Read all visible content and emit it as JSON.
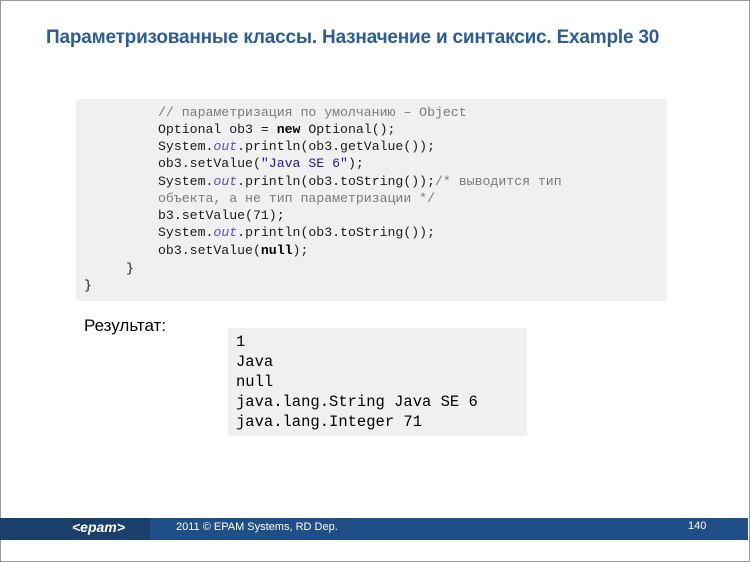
{
  "title": "Параметризованные классы. Назначение и синтаксис. Example 30",
  "code": {
    "l1": "// параметризация по умолчанию – Object",
    "l2_a": "Optional ob3 = ",
    "l2_kw": "new",
    "l2_b": " Optional();",
    "l3_a": "System.",
    "l3_f": "out",
    "l3_b": ".println(ob3.getValue());",
    "l4_a": "ob3.setValue(",
    "l4_s": "\"Java SE 6\"",
    "l4_b": ");",
    "l5_a": "System.",
    "l5_f": "out",
    "l5_b": ".println(ob3.toString());",
    "l5_c": "/* выводится тип",
    "l6": "объекта, а не тип параметризации */",
    "l7": "b3.setValue(71);",
    "l8_a": "System.",
    "l8_f": "out",
    "l8_b": ".println(ob3.toString());",
    "l9_a": "ob3.setValue(",
    "l9_kw": "null",
    "l9_b": ");",
    "l10": "}",
    "l11": "}"
  },
  "result": {
    "label": "Результат:",
    "lines": [
      "1",
      "Java",
      "null",
      "java.lang.String Java SE 6",
      "java.lang.Integer 71"
    ]
  },
  "footer": {
    "logo": "<epam>",
    "text": "2011 © EPAM Systems, RD Dep.",
    "page": "140"
  },
  "colors": {
    "title": "#2a5d99",
    "footer_bar": "#1f4f86",
    "code_bg": "#f0f0f0"
  }
}
